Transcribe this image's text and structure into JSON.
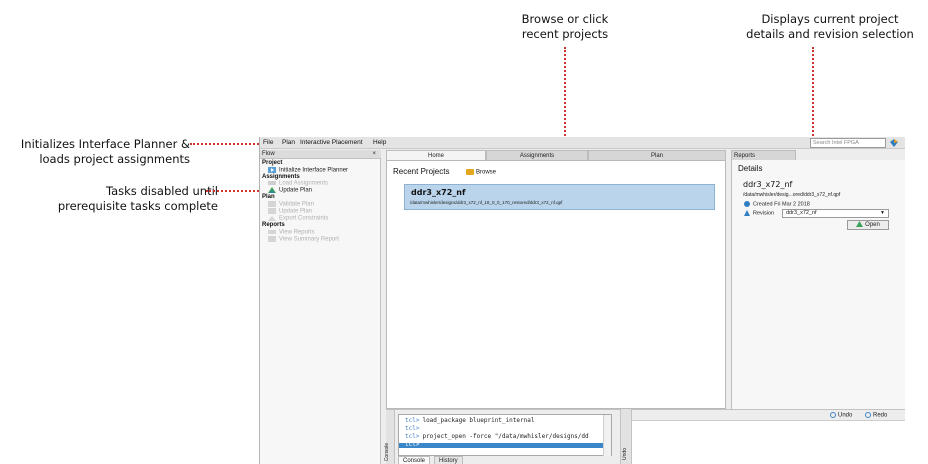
{
  "callouts": {
    "interface_planner_line1": "Initializes Interface Planner &",
    "interface_planner_line2": "loads project assignments",
    "tasks_disabled_line1": "Tasks disabled until",
    "tasks_disabled_line2": "prerequisite tasks complete",
    "browse_line1": "Browse or click",
    "browse_line2": "recent projects",
    "details_line1": "Displays current project",
    "details_line2": "details and revision selection"
  },
  "colors": {
    "callout_red": "#d0342c",
    "selection_blue": "#b9d4eb"
  },
  "menubar": {
    "items": [
      "File",
      "Plan",
      "Interactive Placement",
      "Help"
    ],
    "search_placeholder": "Search Intel FPGA"
  },
  "flow": {
    "header": "Flow",
    "close": "×",
    "project": {
      "title": "Project",
      "items": [
        "Initialize Interface Planner"
      ]
    },
    "assignments": {
      "title": "Assignments",
      "items": [
        "Load Assignments",
        "Update Plan"
      ]
    },
    "plan": {
      "title": "Plan",
      "items": [
        "Validate Plan",
        "Update Plan",
        "Export Constraints"
      ]
    },
    "reports": {
      "title": "Reports",
      "items": [
        "View Reports",
        "View Summary Report"
      ]
    }
  },
  "tabs": [
    "Home",
    "Assignments",
    "Plan"
  ],
  "home": {
    "recent_title": "Recent Projects",
    "browse": "Browse",
    "recent_projects": [
      {
        "name": "ddr3_x72_nf",
        "path": "/data/mwhisler/designs/ddr3_x72_nf_18_0_0_170_restored/ddr3_x72_nf.qpf"
      }
    ]
  },
  "details": {
    "tab": "Reports",
    "title": "Details",
    "project_name": "ddr3_x72_nf",
    "path": "/data/mwhisler/desig...ored/ddr3_x72_nf.qpf",
    "created": "Created  Fri Mar 2 2018",
    "revision_label": "Revision",
    "revision_value": "ddr3_x72_nf",
    "open_label": "Open"
  },
  "console": {
    "side_label": "Console",
    "lines": [
      {
        "prefix": "tcl>",
        "text": "load_package blueprint_internal"
      },
      {
        "prefix": "tcl>",
        "text": ""
      },
      {
        "prefix": "tcl>",
        "text": "project_open -force \"/data/mwhisler/designs/dd"
      },
      {
        "prefix": "tcl>",
        "text": ""
      }
    ],
    "tabs": [
      "Console",
      "History"
    ]
  },
  "undo": {
    "side_label": "Undo",
    "undo_label": "Undo",
    "redo_label": "Redo"
  }
}
